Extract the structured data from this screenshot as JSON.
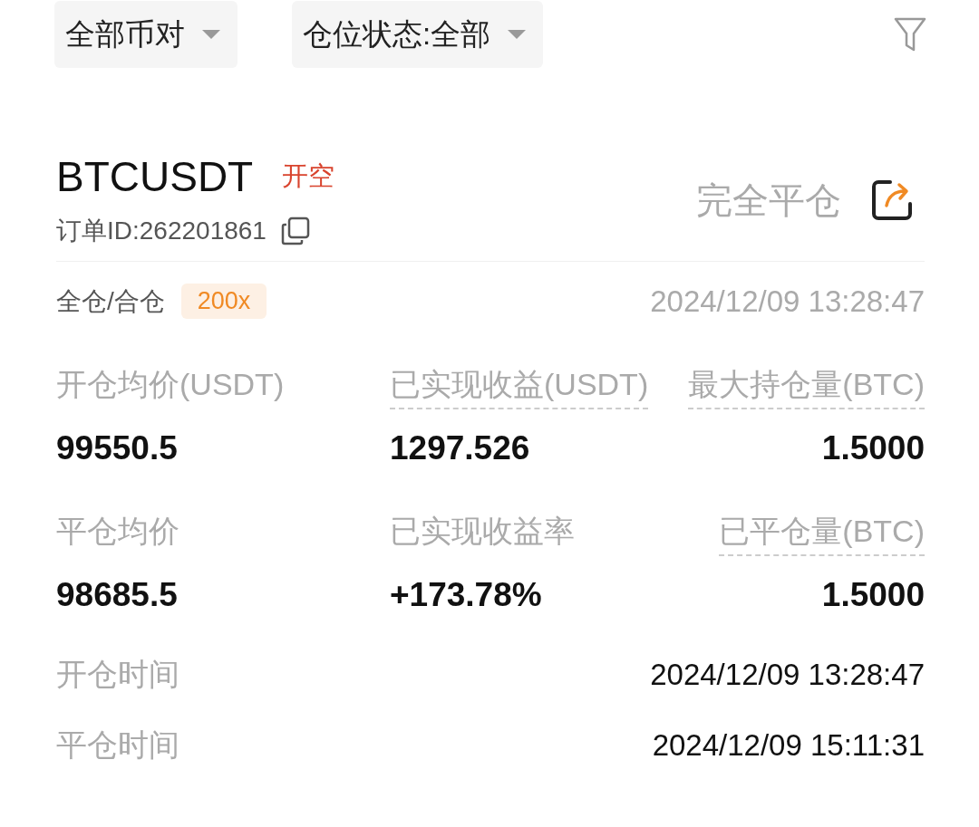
{
  "filters": [
    {
      "label": "全部币对"
    },
    {
      "label": "仓位状态:全部"
    }
  ],
  "order": {
    "symbol": "BTCUSDT",
    "side": "开空",
    "order_id": "订单ID:262201861",
    "status": "完全平仓",
    "margin_mode": "全仓/合仓",
    "leverage": "200x",
    "time": "2024/12/09 13:28:47"
  },
  "stats": [
    {
      "label": "开仓均价(USDT)",
      "value": "99550.5",
      "dashed": false
    },
    {
      "label": "已实现收益(USDT)",
      "value": "1297.526",
      "dashed": true
    },
    {
      "label": "最大持仓量(BTC)",
      "value": "1.5000",
      "dashed": true
    },
    {
      "label": "平仓均价",
      "value": "98685.5",
      "dashed": false
    },
    {
      "label": "已实现收益率",
      "value": "+173.78%",
      "dashed": false
    },
    {
      "label": "已平仓量(BTC)",
      "value": "1.5000",
      "dashed": true
    }
  ],
  "times": [
    {
      "label": "开仓时间",
      "value": "2024/12/09 13:28:47"
    },
    {
      "label": "平仓时间",
      "value": "2024/12/09 15:11:31"
    }
  ]
}
